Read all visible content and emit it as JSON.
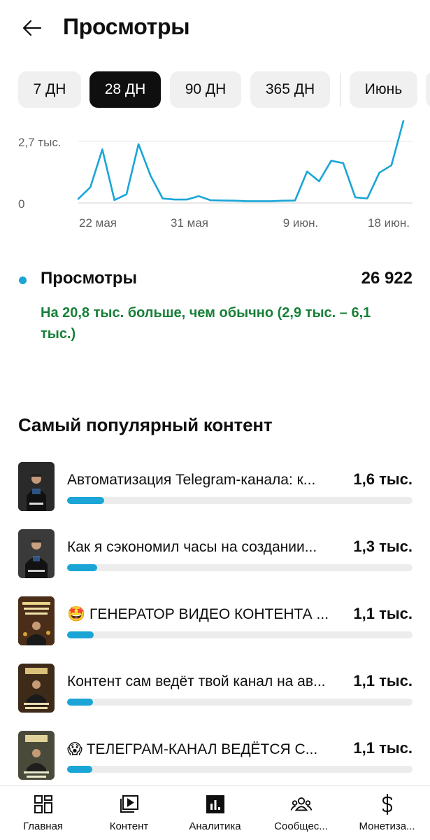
{
  "header": {
    "title": "Просмотры"
  },
  "period_chips": [
    {
      "label": "7 ДН",
      "active": false
    },
    {
      "label": "28 ДН",
      "active": true
    },
    {
      "label": "90 ДН",
      "active": false
    },
    {
      "label": "365 ДН",
      "active": false
    },
    {
      "label": "Июнь",
      "active": false
    }
  ],
  "chart_data": {
    "type": "line",
    "y_tick_labels": [
      "2,7 тыс.",
      "0"
    ],
    "x_tick_labels": [
      "22 мая",
      "31 мая",
      "9 июн.",
      "18 июн."
    ],
    "series": [
      {
        "values": [
          180,
          690,
          2350,
          130,
          380,
          2580,
          1200,
          200,
          150,
          150,
          300,
          120,
          110,
          100,
          80,
          80,
          80,
          100,
          110,
          1380,
          950,
          1850,
          1750,
          250,
          200,
          1330,
          1650,
          3600
        ]
      }
    ],
    "ylim": [
      0,
      3600
    ],
    "grid": true,
    "line_color": "#1aa5d6"
  },
  "metric": {
    "name": "Просмотры",
    "value": "26 922",
    "note": "На 20,8 тыс. больше, чем обычно (2,9 тыс. – 6,1 тыс.)",
    "dot_color": "#1aa5d6",
    "note_color": "#188038"
  },
  "popular": {
    "title": "Самый популярный контент",
    "items": [
      {
        "title": "Автоматизация Telegram-канала: к...",
        "value": "1,6 тыс.",
        "share": 1.0
      },
      {
        "title": "Как я сэкономил часы на создании...",
        "value": "1,3 тыс.",
        "share": 0.81
      },
      {
        "title": "🤩 ГЕНЕРАТОР ВИДЕО КОНТЕНТА ...",
        "value": "1,1 тыс.",
        "share": 0.72
      },
      {
        "title": "Контент сам ведёт твой канал на ав...",
        "value": "1,1 тыс.",
        "share": 0.7
      },
      {
        "title": "😱 ТЕЛЕГРАМ-КАНАЛ ВЕДЁТСЯ С...",
        "value": "1,1 тыс.",
        "share": 0.68
      }
    ]
  },
  "bottom_nav": [
    {
      "label": "Главная",
      "icon": "dashboard-icon"
    },
    {
      "label": "Контент",
      "icon": "content-icon"
    },
    {
      "label": "Аналитика",
      "icon": "analytics-icon"
    },
    {
      "label": "Сообщес...",
      "icon": "community-icon"
    },
    {
      "label": "Монетиза...",
      "icon": "monetization-icon"
    }
  ]
}
